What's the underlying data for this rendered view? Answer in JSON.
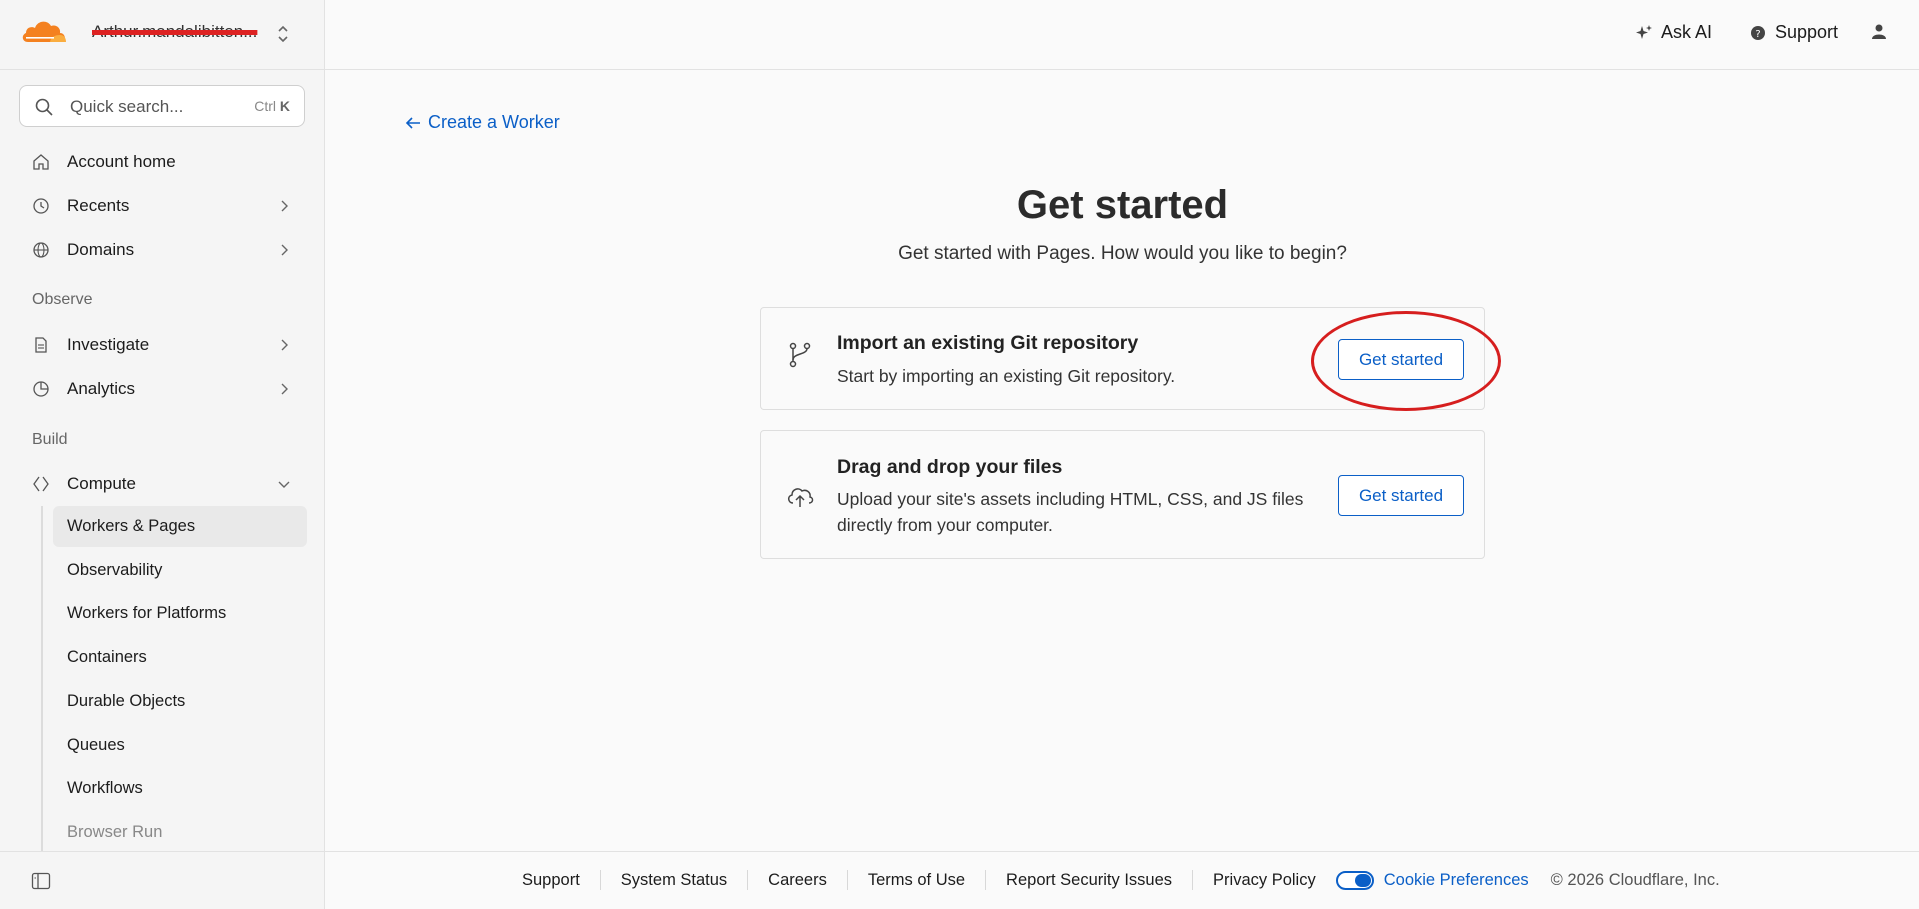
{
  "account": {
    "name": "Arthur.mandalibitten..."
  },
  "search": {
    "placeholder": "Quick search...",
    "shortcut_ctrl": "Ctrl",
    "shortcut_key": "K"
  },
  "sidebar": {
    "items": [
      {
        "label": "Account home"
      },
      {
        "label": "Recents"
      },
      {
        "label": "Domains"
      }
    ],
    "sections": {
      "observe": {
        "label": "Observe",
        "items": [
          {
            "label": "Investigate"
          },
          {
            "label": "Analytics"
          }
        ]
      },
      "build": {
        "label": "Build",
        "items": [
          {
            "label": "Compute"
          }
        ]
      }
    },
    "compute_sub": [
      {
        "label": "Workers & Pages"
      },
      {
        "label": "Observability"
      },
      {
        "label": "Workers for Platforms"
      },
      {
        "label": "Containers"
      },
      {
        "label": "Durable Objects"
      },
      {
        "label": "Queues"
      },
      {
        "label": "Workflows"
      },
      {
        "label": "Browser Run"
      }
    ]
  },
  "topbar": {
    "ask_ai": "Ask AI",
    "support": "Support"
  },
  "main": {
    "back_link": "Create a Worker",
    "title": "Get started",
    "subtitle": "Get started with Pages. How would you like to begin?",
    "cards": [
      {
        "title": "Import an existing Git repository",
        "description": "Start by importing an existing Git repository.",
        "button": "Get started"
      },
      {
        "title": "Drag and drop your files",
        "description": "Upload your site's assets including HTML, CSS, and JS files directly from your computer.",
        "button": "Get started"
      }
    ]
  },
  "footer": {
    "links": [
      "Support",
      "System Status",
      "Careers",
      "Terms of Use",
      "Report Security Issues",
      "Privacy Policy"
    ],
    "cookie": "Cookie Preferences",
    "copyright": "© 2026 Cloudflare, Inc."
  },
  "colors": {
    "accent": "#0b5fc7",
    "brand_orange": "#f48120",
    "annotation_red": "#d61e1e"
  }
}
